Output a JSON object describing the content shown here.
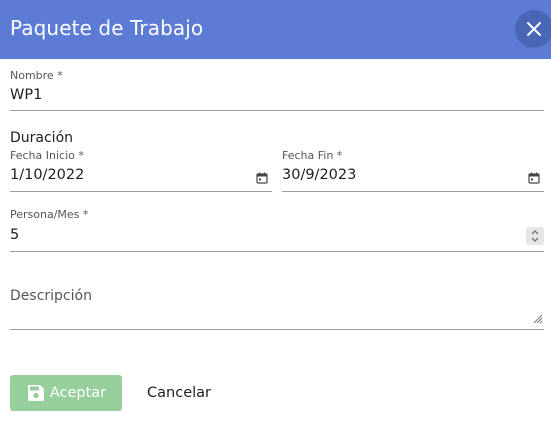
{
  "dialog": {
    "title": "Paquete de Trabajo"
  },
  "form": {
    "name": {
      "label": "Nombre *",
      "value": "WP1"
    },
    "duration_title": "Duración",
    "start_date": {
      "label": "Fecha Inicio *",
      "value": "1/10/2022"
    },
    "end_date": {
      "label": "Fecha Fin *",
      "value": "30/9/2023"
    },
    "person_month": {
      "label": "Persona/Mes *",
      "value": "5"
    },
    "description": {
      "placeholder": "Descripción"
    }
  },
  "actions": {
    "accept_label": "Aceptar",
    "cancel_label": "Cancelar"
  },
  "colors": {
    "header": "#5b7bd5",
    "close_button": "#4a66b6",
    "accept_button": "#96cf9b"
  },
  "icons": {
    "close": "close-icon",
    "calendar": "calendar-icon",
    "save": "save-icon",
    "spinner": "spinner-arrows-icon",
    "resize": "resize-handle-icon"
  }
}
